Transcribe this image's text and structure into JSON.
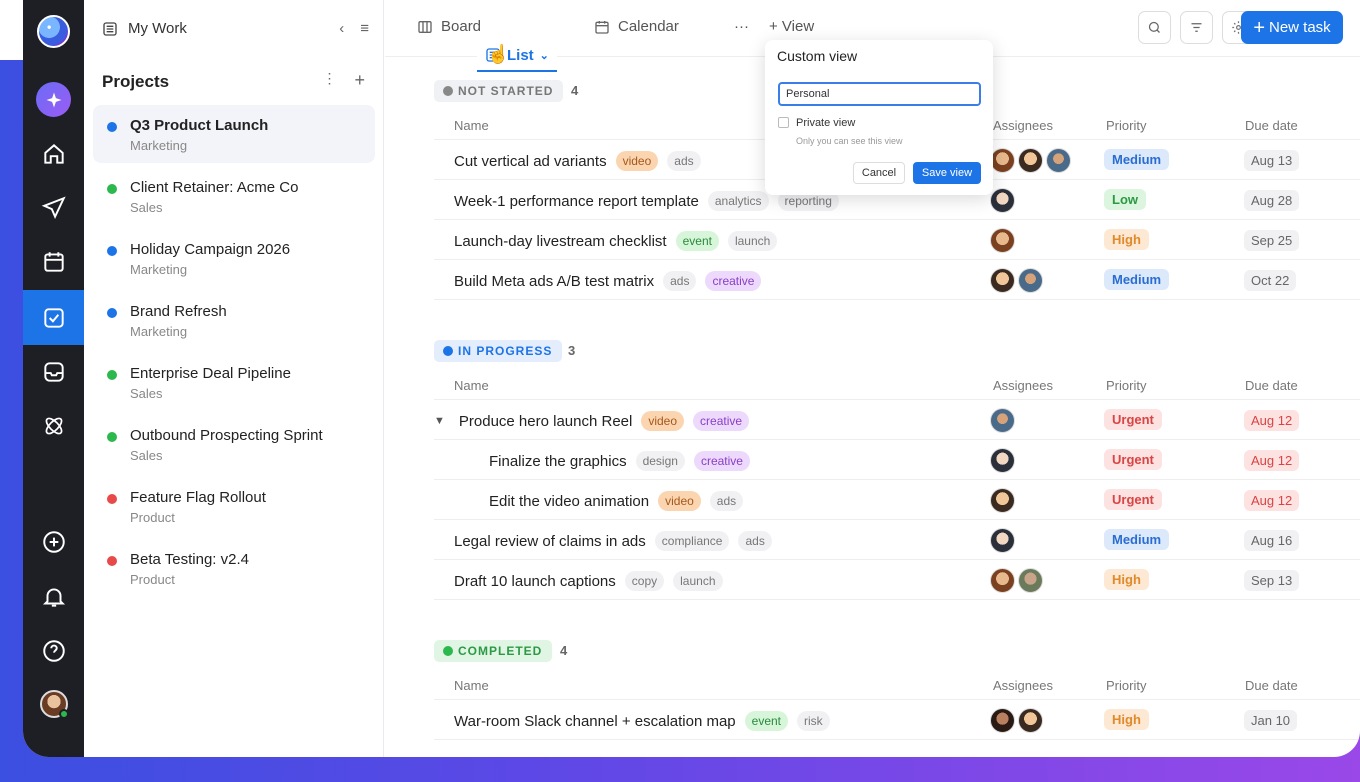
{
  "header": {
    "title": "My Work"
  },
  "projects_title": "Projects",
  "projects": [
    {
      "name": "Q3 Product Launch",
      "team": "Marketing",
      "color": "#1d74e6",
      "selected": true
    },
    {
      "name": "Client Retainer: Acme Co",
      "team": "Sales",
      "color": "#2db84d"
    },
    {
      "name": "Holiday Campaign 2026",
      "team": "Marketing",
      "color": "#1d74e6"
    },
    {
      "name": "Brand Refresh",
      "team": "Marketing",
      "color": "#1d74e6"
    },
    {
      "name": "Enterprise Deal Pipeline",
      "team": "Sales",
      "color": "#2db84d"
    },
    {
      "name": "Outbound Prospecting Sprint",
      "team": "Sales",
      "color": "#2db84d"
    },
    {
      "name": "Feature Flag Rollout",
      "team": "Product",
      "color": "#e84a4a"
    },
    {
      "name": "Beta Testing: v2.4",
      "team": "Product",
      "color": "#e84a4a"
    }
  ],
  "tabs": {
    "board": "Board",
    "list": "List",
    "calendar": "Calendar",
    "more": "···",
    "add_view": "+ View"
  },
  "new_task": "New task",
  "columns": {
    "name": "Name",
    "assignees": "Assignees",
    "priority": "Priority",
    "due": "Due date"
  },
  "sections": {
    "not_started": {
      "label": "NOT STARTED",
      "count": "4"
    },
    "in_progress": {
      "label": "IN PROGRESS",
      "count": "3"
    },
    "completed": {
      "label": "COMPLETED",
      "count": "4"
    }
  },
  "rows": {
    "r0": {
      "name": "Cut vertical ad variants",
      "tags": [
        "video",
        "ads"
      ],
      "priority": "Medium",
      "due": "Aug 13"
    },
    "r1": {
      "name": "Week-1 performance report template",
      "tags": [
        "analytics",
        "reporting"
      ],
      "priority": "Low",
      "due": "Aug 28"
    },
    "r2": {
      "name": "Launch-day livestream checklist",
      "tags": [
        "event",
        "launch"
      ],
      "priority": "High",
      "due": "Sep 25"
    },
    "r3": {
      "name": "Build Meta ads A/B test matrix",
      "tags": [
        "ads",
        "creative"
      ],
      "priority": "Medium",
      "due": "Oct 22"
    },
    "r4": {
      "name": "Produce hero launch Reel",
      "tags": [
        "video",
        "creative"
      ],
      "priority": "Urgent",
      "due": "Aug 12"
    },
    "r5": {
      "name": "Finalize the graphics",
      "tags": [
        "design",
        "creative"
      ],
      "priority": "Urgent",
      "due": "Aug 12"
    },
    "r6": {
      "name": "Edit the video animation",
      "tags": [
        "video",
        "ads"
      ],
      "priority": "Urgent",
      "due": "Aug 12"
    },
    "r7": {
      "name": "Legal review of claims in ads",
      "tags": [
        "compliance",
        "ads"
      ],
      "priority": "Medium",
      "due": "Aug 16"
    },
    "r8": {
      "name": "Draft 10 launch captions",
      "tags": [
        "copy",
        "launch"
      ],
      "priority": "High",
      "due": "Sep 13"
    },
    "r9": {
      "name": "War-room Slack channel + escalation map",
      "tags": [
        "event",
        "risk"
      ],
      "priority": "High",
      "due": "Jan 10"
    }
  },
  "popup": {
    "title": "Custom view",
    "input_value": "Personal",
    "private_label": "Private view",
    "private_hint": "Only you can see this view",
    "cancel": "Cancel",
    "save": "Save view"
  },
  "colors": {
    "accent": "#1d74e6",
    "rail": "#1e1f25"
  }
}
